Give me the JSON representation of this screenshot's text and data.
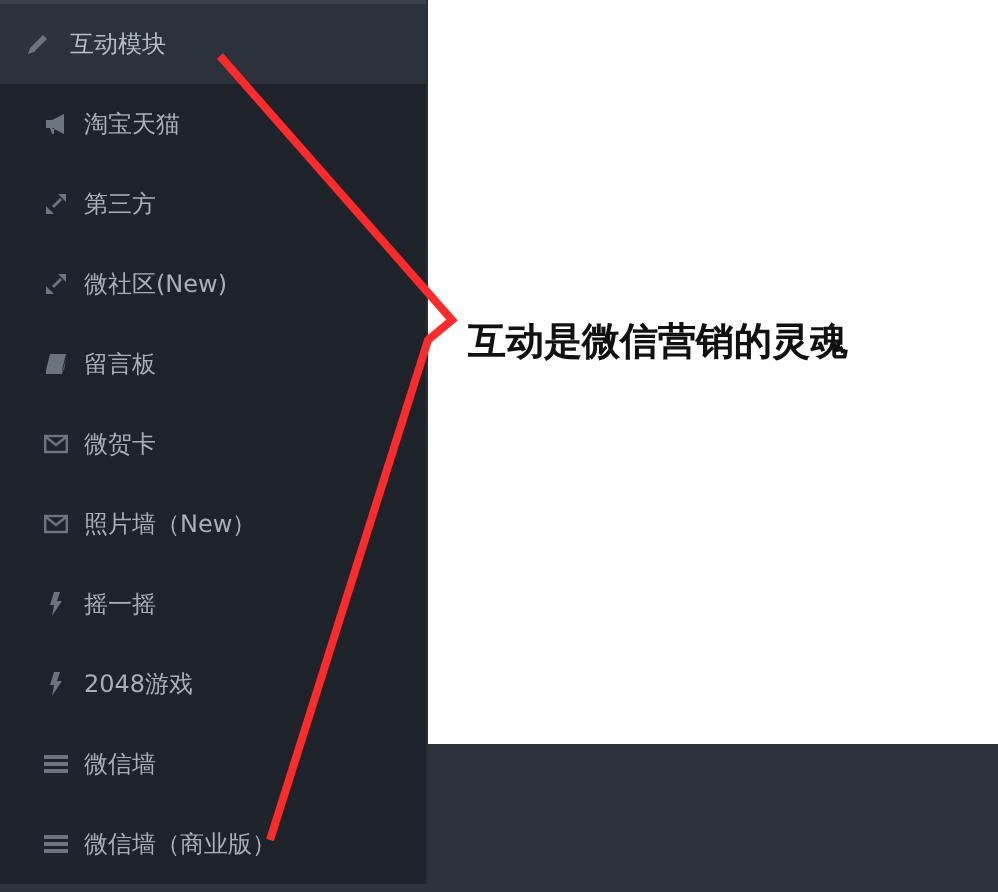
{
  "sidebar": {
    "group": {
      "label": "互动模块",
      "children": [
        {
          "label": "淘宝天猫",
          "kind": "promo"
        },
        {
          "label": "第三方",
          "kind": "link"
        },
        {
          "label": "微社区(New)",
          "kind": "link"
        },
        {
          "label": "留言板",
          "kind": "book"
        },
        {
          "label": "微贺卡",
          "kind": "mail"
        },
        {
          "label": "照片墙（New）",
          "kind": "mail"
        },
        {
          "label": "摇一摇",
          "kind": "bolt"
        },
        {
          "label": "2048游戏",
          "kind": "bolt"
        },
        {
          "label": "微信墙",
          "kind": "list"
        },
        {
          "label": "微信墙（商业版）",
          "kind": "list"
        }
      ]
    }
  },
  "callout": {
    "text": "互动是微信营销的灵魂"
  }
}
